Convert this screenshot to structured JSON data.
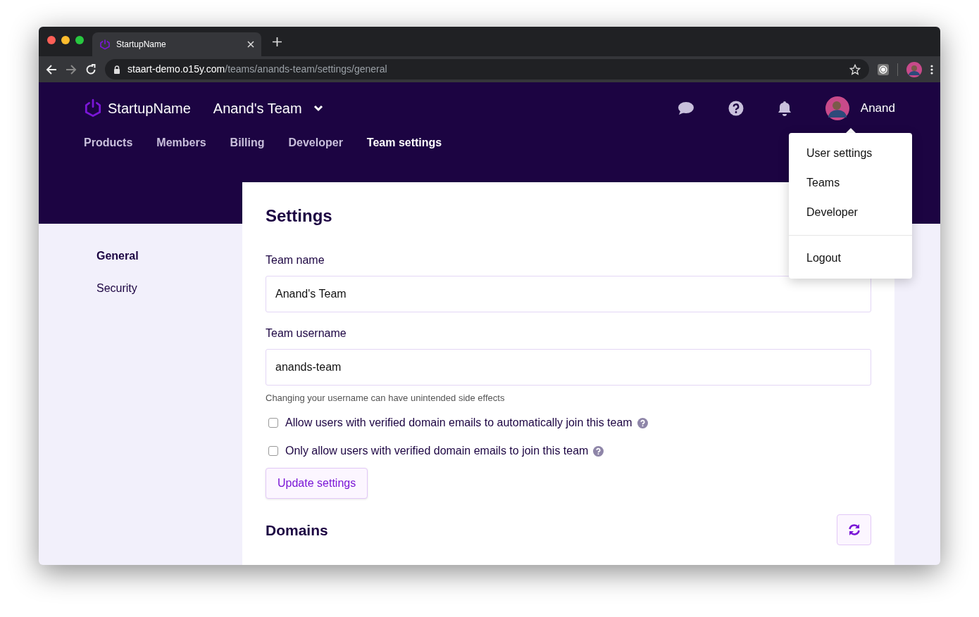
{
  "browser": {
    "tab_title": "StartupName",
    "url_host": "staart-demo.o15y.com",
    "url_path": "/teams/anands-team/settings/general"
  },
  "header": {
    "brand": "StartupName",
    "team": "Anand's Team",
    "user_name": "Anand",
    "nav": [
      {
        "label": "Products",
        "selected": false
      },
      {
        "label": "Members",
        "selected": false
      },
      {
        "label": "Billing",
        "selected": false
      },
      {
        "label": "Developer",
        "selected": false
      },
      {
        "label": "Team settings",
        "selected": true
      }
    ]
  },
  "user_menu": {
    "items": [
      "User settings",
      "Teams",
      "Developer"
    ],
    "footer_items": [
      "Logout"
    ]
  },
  "sidebar": {
    "items": [
      {
        "label": "General",
        "selected": true
      },
      {
        "label": "Security",
        "selected": false
      }
    ]
  },
  "settings": {
    "title": "Settings",
    "fields": [
      {
        "label": "Team name",
        "value": "Anand's Team"
      },
      {
        "label": "Team username",
        "value": "anands-team",
        "help": "Changing your username can have unintended side effects"
      }
    ],
    "checkboxes": [
      {
        "label": "Allow users with verified domain emails to automatically join this team",
        "checked": false
      },
      {
        "label": "Only allow users with verified domain emails to join this team",
        "checked": false
      }
    ],
    "button": "Update settings"
  },
  "domains": {
    "title": "Domains"
  }
}
